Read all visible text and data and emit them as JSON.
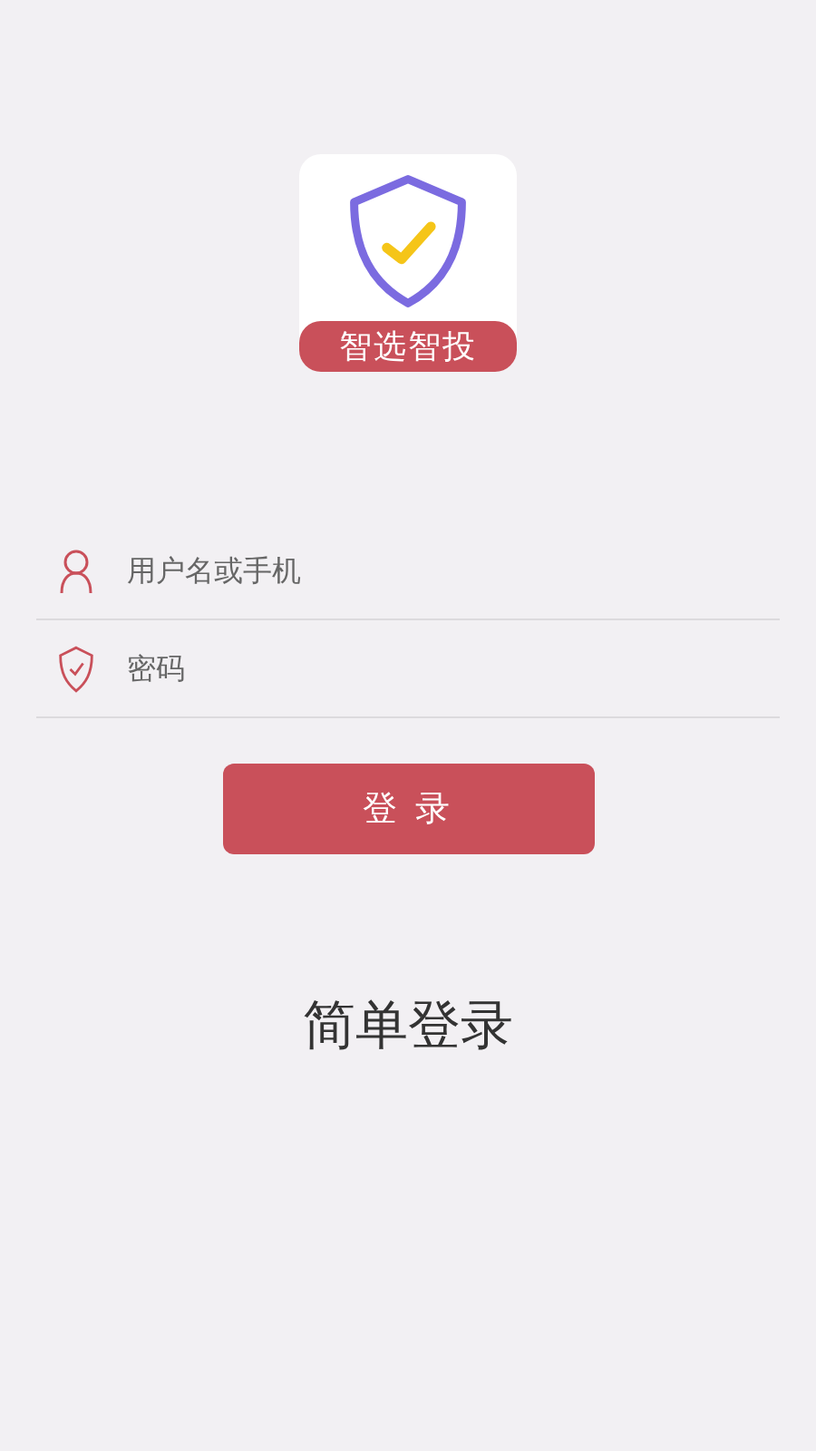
{
  "logo": {
    "caption": "智选智投"
  },
  "fields": [
    {
      "kind": "user",
      "placeholder": "用户名或手机"
    },
    {
      "kind": "password",
      "placeholder": "密码"
    }
  ],
  "login_button": "登 录",
  "simple_login": "简单登录"
}
